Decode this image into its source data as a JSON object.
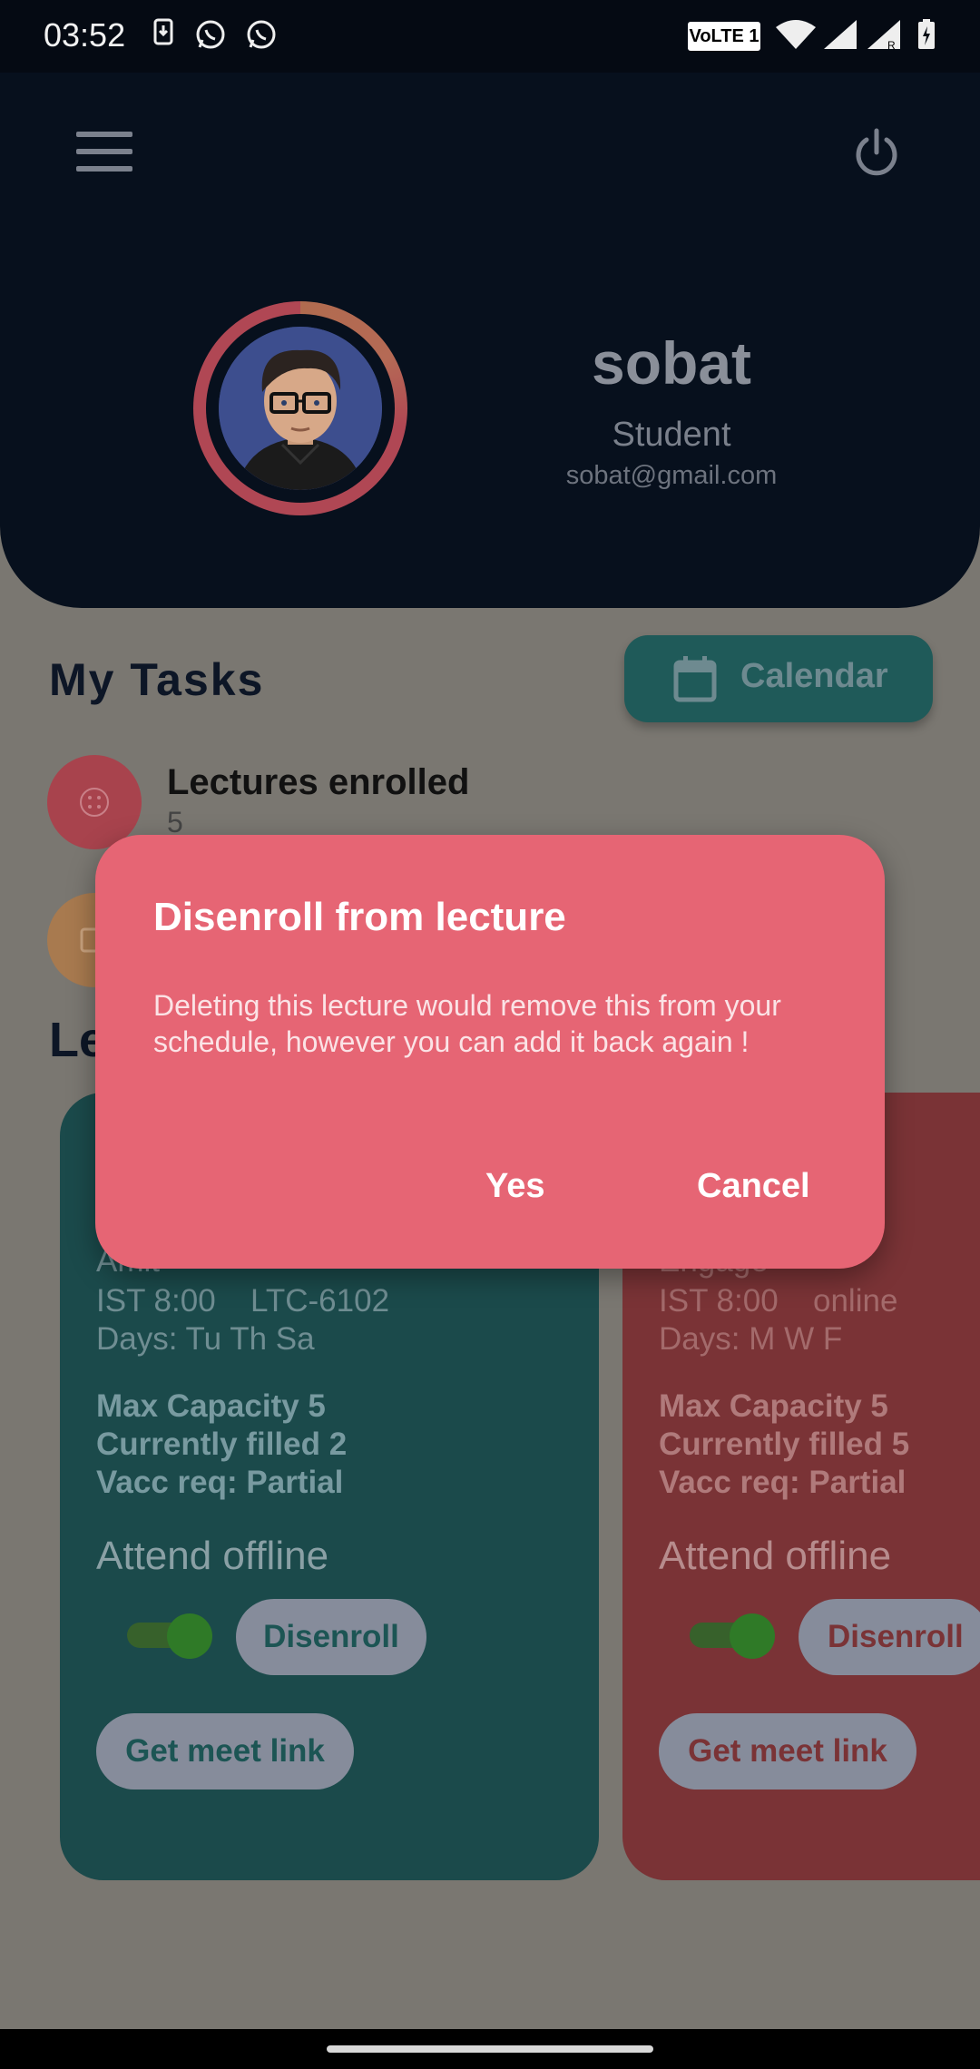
{
  "status_bar": {
    "time": "03:52",
    "network_badge": "VoLTE 1",
    "icons": [
      "download-icon",
      "whatsapp-icon",
      "whatsapp-icon",
      "wifi-icon",
      "signal-icon",
      "signal-roaming-icon",
      "battery-charging-icon"
    ]
  },
  "header": {
    "menu_icon": "hamburger-menu-icon",
    "power_icon": "power-icon",
    "user_name": "sobat",
    "user_role": "Student",
    "user_email": "sobat@gmail.com"
  },
  "tasks": {
    "title": "My Tasks",
    "calendar_label": "Calendar",
    "items": [
      {
        "label": "Lectures enrolled",
        "count": "5",
        "color": "#b04754"
      },
      {
        "label": "",
        "count": "",
        "color": "#a87a4f"
      }
    ]
  },
  "lectures_section_title": "Le",
  "cards": [
    {
      "color": "#1b4a4b",
      "instructor": "Amit",
      "time": "IST 8:00",
      "location": "LTC-6102",
      "days": "Days: Tu Th Sa",
      "max_capacity": "Max Capacity  5",
      "currently_filled": "Currently filled  2",
      "vacc_req": "Vacc req:  Partial",
      "attend_label": "Attend offline",
      "attend_offline_on": true,
      "disenroll_label": "Disenroll",
      "meet_link_label": "Get meet link"
    },
    {
      "color": "#7a3336",
      "instructor": "Engage",
      "time": "IST 8:00",
      "location": "online",
      "days": "Days: M W F",
      "max_capacity": "Max Capacity  5",
      "currently_filled": "Currently filled  5",
      "vacc_req": "Vacc req:  Partial",
      "attend_label": "Attend offline",
      "attend_offline_on": true,
      "disenroll_label": "Disenroll",
      "meet_link_label": "Get meet link"
    }
  ],
  "dialog": {
    "title": "Disenroll from lecture",
    "body": "Deleting this lecture would remove this from your schedule, however you can add it back again !",
    "confirm_label": "Yes",
    "cancel_label": "Cancel",
    "background": "#e66574"
  }
}
